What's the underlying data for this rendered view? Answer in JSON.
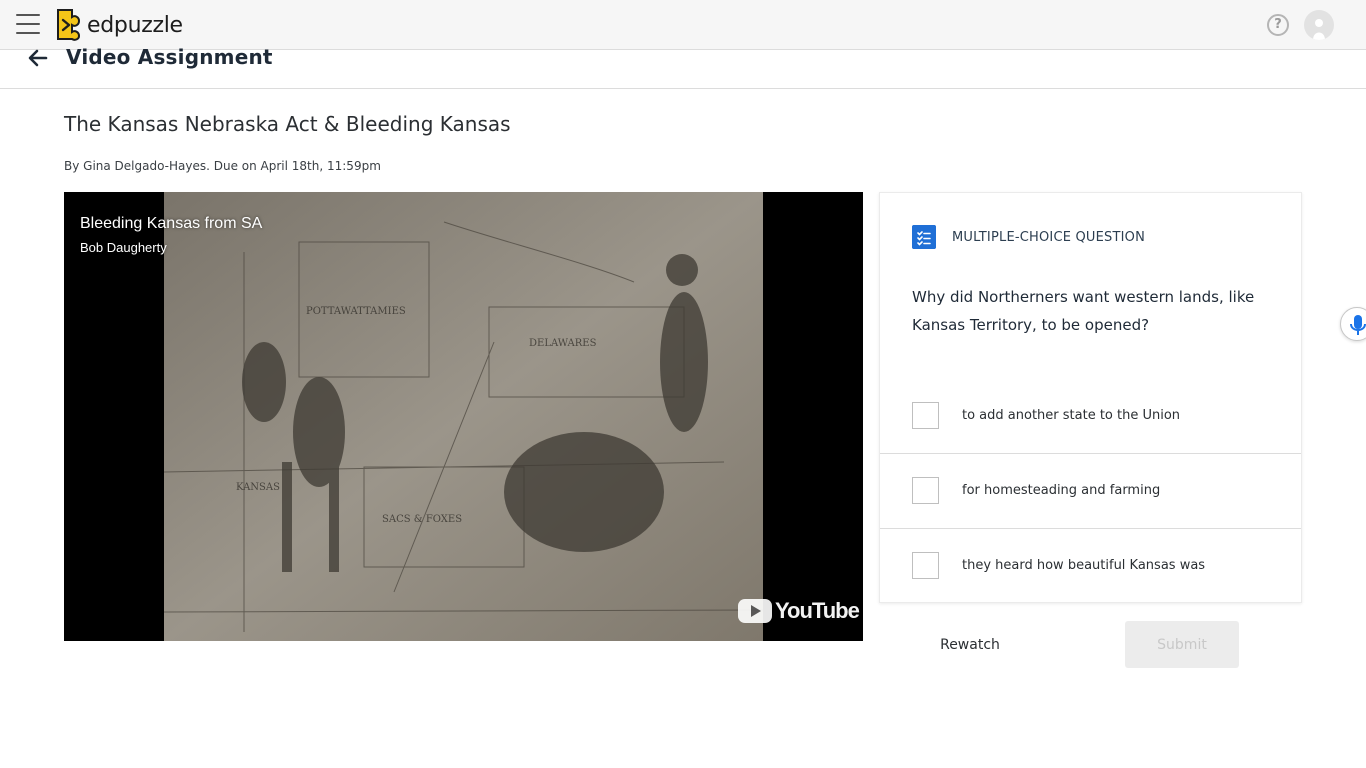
{
  "topbar": {
    "logo_text": "edpuzzle",
    "help_icon": "question-circle-icon",
    "menu_icon": "hamburger-menu-icon",
    "avatar_icon": "user-avatar"
  },
  "header": {
    "title": "Video Assignment",
    "back_icon": "arrow-left-icon"
  },
  "assignment": {
    "title": "The Kansas Nebraska Act & Bleeding Kansas",
    "byline": "By Gina Delgado-Hayes. Due on April 18th, 11:59pm"
  },
  "video": {
    "title": "Bleeding Kansas from SA",
    "author": "Bob Daugherty",
    "brand": "YouTube"
  },
  "question": {
    "type_label": "MULTIPLE-CHOICE QUESTION",
    "text": "Why did Northerners want western lands, like Kansas Territory, to be opened?",
    "choices": [
      {
        "label": "to add another state to the Union",
        "checked": false
      },
      {
        "label": "for homesteading and farming",
        "checked": false
      },
      {
        "label": "they heard how beautiful Kansas was",
        "checked": false
      }
    ]
  },
  "actions": {
    "rewatch_label": "Rewatch",
    "submit_label": "Submit",
    "submit_enabled": false
  },
  "colors": {
    "accent": "#1f6fd6",
    "logo_yellow": "#f5c518"
  }
}
